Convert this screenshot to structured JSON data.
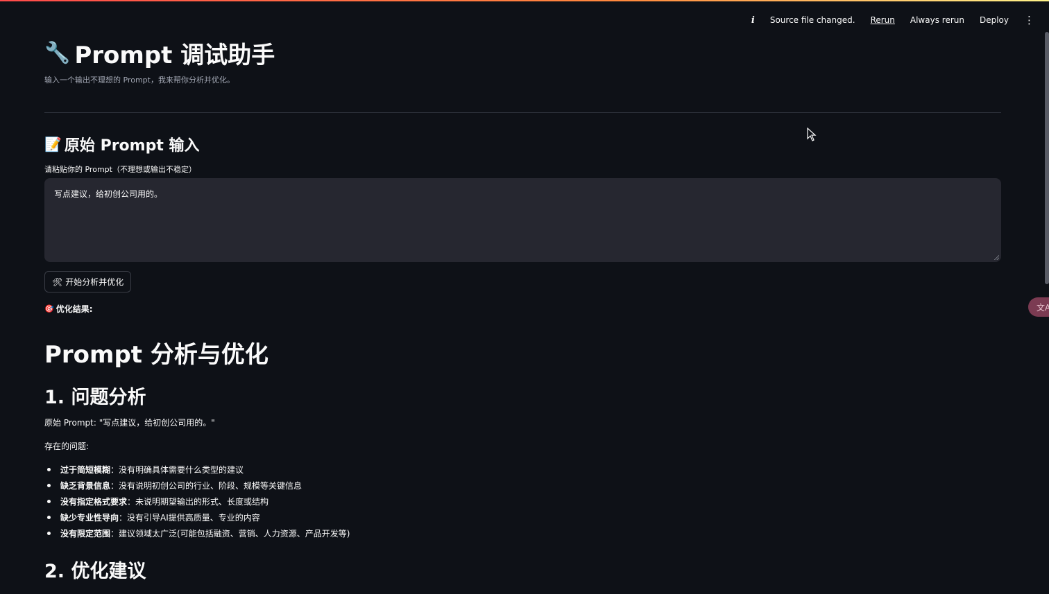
{
  "toolbar": {
    "info_icon": "i",
    "status": "Source file changed.",
    "rerun": "Rerun",
    "always_rerun": "Always rerun",
    "deploy": "Deploy",
    "menu_icon": "⋮"
  },
  "header": {
    "icon": "🔧",
    "title": "Prompt 调试助手",
    "subtitle": "输入一个输出不理想的 Prompt，我来帮你分析并优化。"
  },
  "input_section": {
    "icon": "📝",
    "heading": "原始 Prompt 输入",
    "label": "请粘贴你的 Prompt（不理想或输出不稳定）",
    "value": "写点建议，给初创公司用的。"
  },
  "action": {
    "icon": "🛠",
    "label": "开始分析并优化"
  },
  "result": {
    "icon": "🎯",
    "label": "优化结果:",
    "h1": "Prompt 分析与优化",
    "section1_heading": "1. 问题分析",
    "original_line": "原始 Prompt: \"写点建议，给初创公司用的。\"",
    "issues_intro": "存在的问题:",
    "issues": [
      {
        "term": "过于简短模糊",
        "desc": "：没有明确具体需要什么类型的建议"
      },
      {
        "term": "缺乏背景信息",
        "desc": "：没有说明初创公司的行业、阶段、规模等关键信息"
      },
      {
        "term": "没有指定格式要求",
        "desc": "：未说明期望输出的形式、长度或结构"
      },
      {
        "term": "缺少专业性导向",
        "desc": "：没有引导AI提供高质量、专业的内容"
      },
      {
        "term": "没有限定范围",
        "desc": "：建议领域太广泛(可能包括融资、营销、人力资源、产品开发等)"
      }
    ],
    "section2_heading": "2. 优化建议"
  },
  "colors": {
    "background": "#0e1117",
    "input_bg": "#262730",
    "accent": "#ff4b4b"
  }
}
